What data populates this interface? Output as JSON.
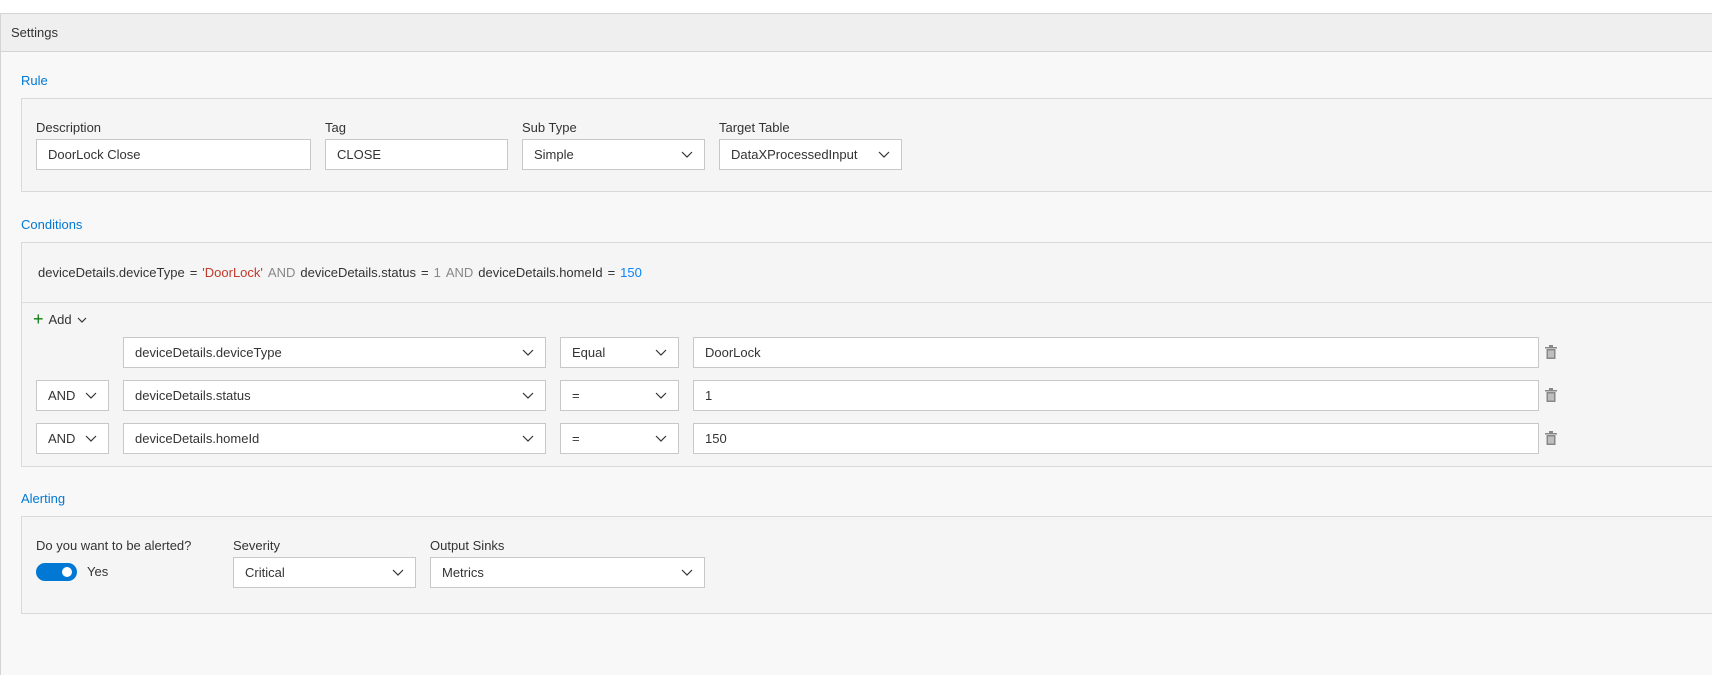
{
  "panel": {
    "title": "Settings"
  },
  "rule": {
    "section_label": "Rule",
    "description": {
      "label": "Description",
      "value": "DoorLock Close"
    },
    "tag": {
      "label": "Tag",
      "value": "CLOSE"
    },
    "sub_type": {
      "label": "Sub Type",
      "value": "Simple"
    },
    "target_table": {
      "label": "Target Table",
      "value": "DataXProcessedInput"
    }
  },
  "conditions": {
    "section_label": "Conditions",
    "query": {
      "f1": "deviceDetails.deviceType",
      "op1": "=",
      "v1": "'DoorLock'",
      "and1": "AND",
      "f2": "deviceDetails.status",
      "op2": "=",
      "v2": "1",
      "and2": "AND",
      "f3": "deviceDetails.homeId",
      "op3": "=",
      "v3": "150"
    },
    "add_label": "Add",
    "rows": [
      {
        "conjunction": "",
        "field": "deviceDetails.deviceType",
        "operator": "Equal",
        "value": "DoorLock"
      },
      {
        "conjunction": "AND",
        "field": "deviceDetails.status",
        "operator": "=",
        "value": "1"
      },
      {
        "conjunction": "AND",
        "field": "deviceDetails.homeId",
        "operator": "=",
        "value": "150"
      }
    ]
  },
  "alerting": {
    "section_label": "Alerting",
    "alert_question": "Do you want to be alerted?",
    "toggle_value": "Yes",
    "severity": {
      "label": "Severity",
      "value": "Critical"
    },
    "output_sinks": {
      "label": "Output Sinks",
      "value": "Metrics"
    }
  },
  "colors": {
    "accent": "#0078d4",
    "string_literal": "#c0392b",
    "number_literal": "#0a84ff",
    "add_icon": "#107c10"
  },
  "icons": {
    "chevron": "chevron-down-icon",
    "add": "plus-icon",
    "delete": "trash-icon"
  }
}
